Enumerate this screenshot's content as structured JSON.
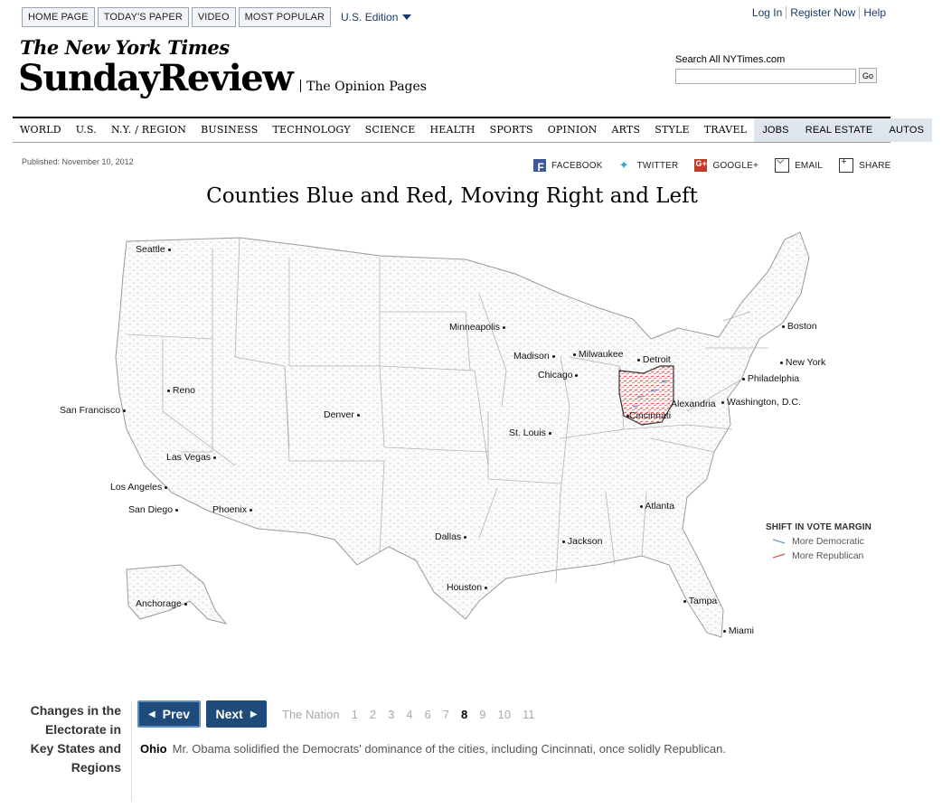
{
  "topnav": {
    "items": [
      "HOME PAGE",
      "TODAY'S PAPER",
      "VIDEO",
      "MOST POPULAR"
    ],
    "edition": "U.S. Edition"
  },
  "account": {
    "login": "Log In",
    "register": "Register Now",
    "help": "Help"
  },
  "masthead": {
    "logo": "The New York Times",
    "section": "SundayReview",
    "subsection": "The Opinion Pages"
  },
  "search": {
    "label": "Search All NYTimes.com",
    "button": "Go",
    "value": ""
  },
  "sections": {
    "main": [
      "WORLD",
      "U.S.",
      "N.Y. / REGION",
      "BUSINESS",
      "TECHNOLOGY",
      "SCIENCE",
      "HEALTH",
      "SPORTS",
      "OPINION",
      "ARTS",
      "STYLE",
      "TRAVEL"
    ],
    "classifieds": [
      "JOBS",
      "REAL ESTATE",
      "AUTOS"
    ]
  },
  "published": "Published: November 10, 2012",
  "share": {
    "facebook": "FACEBOOK",
    "twitter": "TWITTER",
    "google": "GOOGLE+",
    "email": "EMAIL",
    "share": "SHARE"
  },
  "headline": "Counties Blue and Red, Moving Right and Left",
  "map": {
    "cities": [
      "Seattle",
      "Reno",
      "San Francisco",
      "Las Vegas",
      "Los Angeles",
      "San Diego",
      "Phoenix",
      "Denver",
      "Minneapolis",
      "Madison",
      "Milwaukee",
      "Chicago",
      "Detroit",
      "St. Louis",
      "Cincinnati",
      "Alexandria",
      "Washington, D.C.",
      "Philadelphia",
      "New York",
      "Boston",
      "Atlanta",
      "Jackson",
      "Dallas",
      "Houston",
      "Tampa",
      "Miami",
      "Anchorage"
    ],
    "highlighted_state": "Ohio",
    "colors": {
      "democratic": "#5b9bd5",
      "republican": "#d9534f"
    }
  },
  "legend": {
    "title": "SHIFT IN VOTE MARGIN",
    "dem": "More Democratic",
    "rep": "More Republican"
  },
  "side_title": "Changes in the Electorate in Key States and Regions",
  "pager": {
    "prev": "Prev",
    "next": "Next",
    "items": [
      "The Nation",
      "1",
      "2",
      "3",
      "4",
      "6",
      "7",
      "8",
      "9",
      "10",
      "11"
    ],
    "active": "8"
  },
  "caption": {
    "state": "Ohio",
    "text": "Mr. Obama solidified the Democrats' dominance of the cities, including Cincinnati, once solidly Republican."
  }
}
